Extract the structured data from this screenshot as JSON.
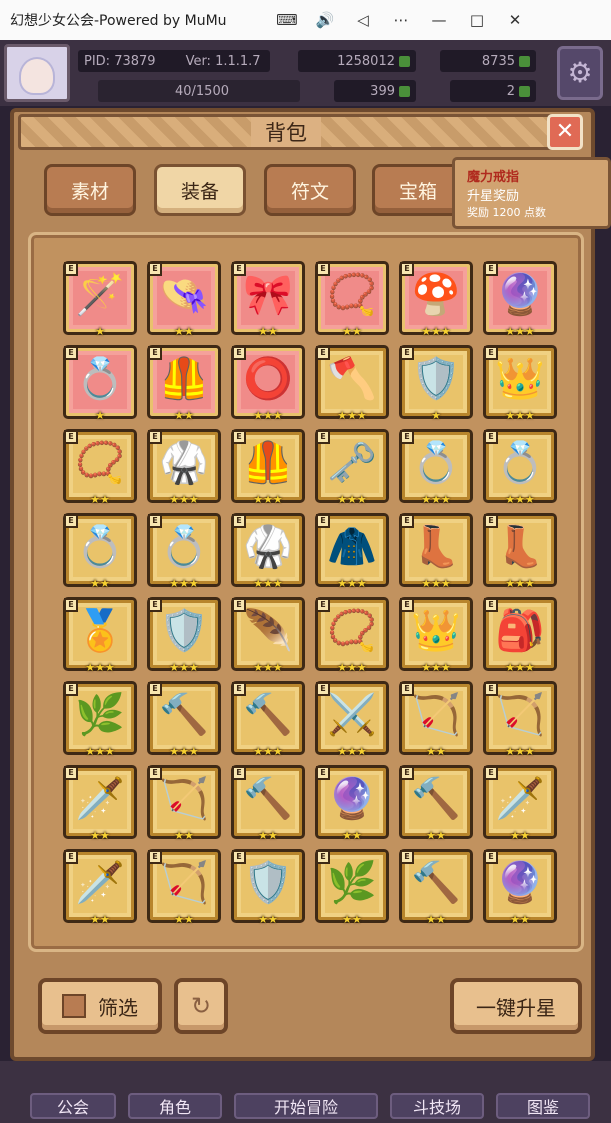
{
  "window": {
    "title": "幻想少女公会-Powered by MuMu"
  },
  "hud": {
    "pid": "PID: 73879",
    "version": "Ver: 1.1.1.7",
    "xp": "40/1500",
    "gold": "1258012",
    "gems": "8735",
    "clover": "399",
    "boots": "2"
  },
  "panel": {
    "title": "背包"
  },
  "tabs": [
    "素材",
    "装备",
    "符文",
    "宝箱"
  ],
  "tooltip": {
    "name": "魔力戒指",
    "line2": "升星奖励",
    "line3": "奖励 1200 点数"
  },
  "items": [
    {
      "bg": "red",
      "g": "🪄",
      "s": "★"
    },
    {
      "bg": "red",
      "g": "👒",
      "s": "★★"
    },
    {
      "bg": "red",
      "g": "🎀",
      "s": "★★"
    },
    {
      "bg": "red",
      "g": "📿",
      "s": "★★"
    },
    {
      "bg": "red",
      "g": "🍄",
      "s": "★★★"
    },
    {
      "bg": "red",
      "g": "🔮",
      "s": "★★★"
    },
    {
      "bg": "red",
      "g": "💍",
      "s": "★"
    },
    {
      "bg": "red",
      "g": "🦺",
      "s": "★★"
    },
    {
      "bg": "red",
      "g": "⭕",
      "s": "★★★"
    },
    {
      "bg": "gold",
      "g": "🪓",
      "s": "★★★"
    },
    {
      "bg": "gold",
      "g": "🛡️",
      "s": "★"
    },
    {
      "bg": "gold",
      "g": "👑",
      "s": "★★★"
    },
    {
      "bg": "gold",
      "g": "📿",
      "s": "★★"
    },
    {
      "bg": "gold",
      "g": "🥋",
      "s": "★★★"
    },
    {
      "bg": "gold",
      "g": "🦺",
      "s": "★★★"
    },
    {
      "bg": "gold",
      "g": "🗝️",
      "s": "★★★"
    },
    {
      "bg": "gold",
      "g": "💍",
      "s": "★★★"
    },
    {
      "bg": "gold",
      "g": "💍",
      "s": "★★★"
    },
    {
      "bg": "gold",
      "g": "💍",
      "s": "★★"
    },
    {
      "bg": "gold",
      "g": "💍",
      "s": "★★★"
    },
    {
      "bg": "gold",
      "g": "🥋",
      "s": "★★★"
    },
    {
      "bg": "gold",
      "g": "🧥",
      "s": "★★★"
    },
    {
      "bg": "gold",
      "g": "👢",
      "s": "★★★"
    },
    {
      "bg": "gold",
      "g": "👢",
      "s": "★★★"
    },
    {
      "bg": "gold",
      "g": "🏅",
      "s": "★★★"
    },
    {
      "bg": "gold",
      "g": "🛡️",
      "s": "★★★"
    },
    {
      "bg": "gold",
      "g": "🪶",
      "s": "★★★"
    },
    {
      "bg": "gold",
      "g": "📿",
      "s": "★★★"
    },
    {
      "bg": "gold",
      "g": "👑",
      "s": "★★★"
    },
    {
      "bg": "gold",
      "g": "🎒",
      "s": "★★★"
    },
    {
      "bg": "gold",
      "g": "🌿",
      "s": "★★★"
    },
    {
      "bg": "gold",
      "g": "🔨",
      "s": "★★★"
    },
    {
      "bg": "gold",
      "g": "🔨",
      "s": "★★★"
    },
    {
      "bg": "gold",
      "g": "⚔️",
      "s": "★★★"
    },
    {
      "bg": "gold",
      "g": "🏹",
      "s": "★★"
    },
    {
      "bg": "gold",
      "g": "🏹",
      "s": "★★★"
    },
    {
      "bg": "gold",
      "g": "🗡️",
      "s": "★★"
    },
    {
      "bg": "gold",
      "g": "🏹",
      "s": "★★"
    },
    {
      "bg": "gold",
      "g": "🔨",
      "s": "★★"
    },
    {
      "bg": "gold",
      "g": "🔮",
      "s": "★★"
    },
    {
      "bg": "gold",
      "g": "🔨",
      "s": "★★"
    },
    {
      "bg": "gold",
      "g": "🗡️",
      "s": "★★"
    },
    {
      "bg": "gold",
      "g": "🗡️",
      "s": "★★"
    },
    {
      "bg": "gold",
      "g": "🏹",
      "s": "★★"
    },
    {
      "bg": "gold",
      "g": "🛡️",
      "s": "★★"
    },
    {
      "bg": "gold",
      "g": "🌿",
      "s": "★★"
    },
    {
      "bg": "gold",
      "g": "🔨",
      "s": "★★"
    },
    {
      "bg": "gold",
      "g": "🔮",
      "s": "★★"
    }
  ],
  "buttons": {
    "filter": "筛选",
    "upgrade_all": "一键升星"
  },
  "nav": [
    "公会",
    "角色",
    "开始冒险",
    "斗技场",
    "图鉴"
  ]
}
